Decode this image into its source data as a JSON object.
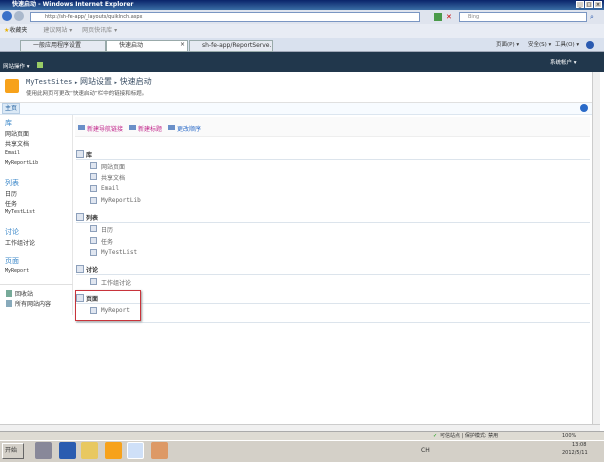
{
  "window": {
    "title": "快速启动 - Windows Internet Explorer"
  },
  "browser": {
    "url": "http://sh-fe-app/_layouts/quiklnch.aspx",
    "search_placeholder": "Bing",
    "favorites_label": "收藏夹",
    "fav_links": [
      "建议网站 ▾",
      "网页快讯库 ▾"
    ],
    "tabs": [
      "一般应用程序设置",
      "快速启动",
      "sh-fe-app/ReportServe..."
    ],
    "tools": [
      "页面(P) ▾",
      "安全(S) ▾",
      "工具(O) ▾"
    ]
  },
  "ribbon": {
    "site_actions": "网站操作 ▾",
    "user": "系统帐户 ▾"
  },
  "header": {
    "site": "MyTestSites",
    "crumb2": "网站设置",
    "crumb3": "快速启动",
    "sep": "▸",
    "description": "使用此网页可更改“快速启动”栏中的链接和标题。"
  },
  "tabrow": {
    "home": "主页"
  },
  "leftnav": {
    "sections": [
      {
        "title": "库",
        "items": [
          "网站页面",
          "共享文档",
          "Email",
          "MyReportLib"
        ]
      },
      {
        "title": "列表",
        "items": [
          "日历",
          "任务",
          "MyTestList"
        ]
      },
      {
        "title": "讨论",
        "items": [
          "工作组讨论"
        ]
      },
      {
        "title": "页面",
        "items": [
          "MyReport"
        ]
      }
    ],
    "recycle": "回收站",
    "all_content": "所有网站内容"
  },
  "toolbar": {
    "new_link": "新建导航链接",
    "new_heading": "新建标题",
    "reorder": "更改顺序"
  },
  "content": {
    "sections": [
      {
        "title": "库",
        "items": [
          "网站页面",
          "共享文档",
          "Email",
          "MyReportLib"
        ]
      },
      {
        "title": "列表",
        "items": [
          "日历",
          "任务",
          "MyTestList"
        ]
      },
      {
        "title": "讨论",
        "items": [
          "工作组讨论"
        ]
      },
      {
        "title": "页面",
        "items": [
          "MyReport"
        ]
      }
    ]
  },
  "status": {
    "zone": "可信站点 | 保护模式: 禁用",
    "zoom": "100%"
  },
  "taskbar": {
    "start": "开始",
    "lang": "CH",
    "time": "13:08",
    "date": "2012/5/11"
  }
}
